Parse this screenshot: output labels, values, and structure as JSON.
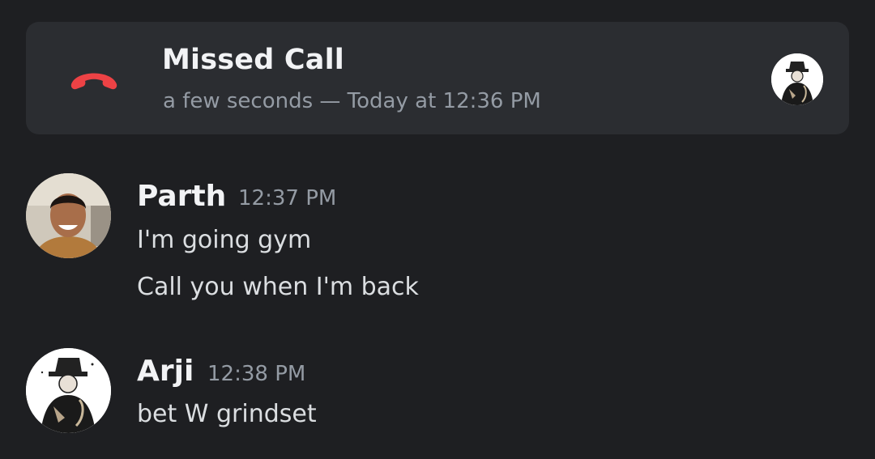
{
  "call": {
    "title": "Missed Call",
    "subtitle": "a few seconds — Today at 12:36 PM",
    "icon": "phone-hangup-icon",
    "icon_color": "#ed4245",
    "avatar": "arji-avatar"
  },
  "messages": [
    {
      "author": "Parth",
      "time": "12:37 PM",
      "lines": [
        "I'm going gym",
        "Call you when I'm back"
      ],
      "avatar": "parth-avatar"
    },
    {
      "author": "Arji",
      "time": "12:38 PM",
      "lines": [
        "bet W grindset"
      ],
      "avatar": "arji-avatar"
    }
  ],
  "theme": {
    "background": "#1e1f22",
    "card": "#2b2d31",
    "text_primary": "#f2f3f5",
    "text_secondary": "#949ba4"
  }
}
